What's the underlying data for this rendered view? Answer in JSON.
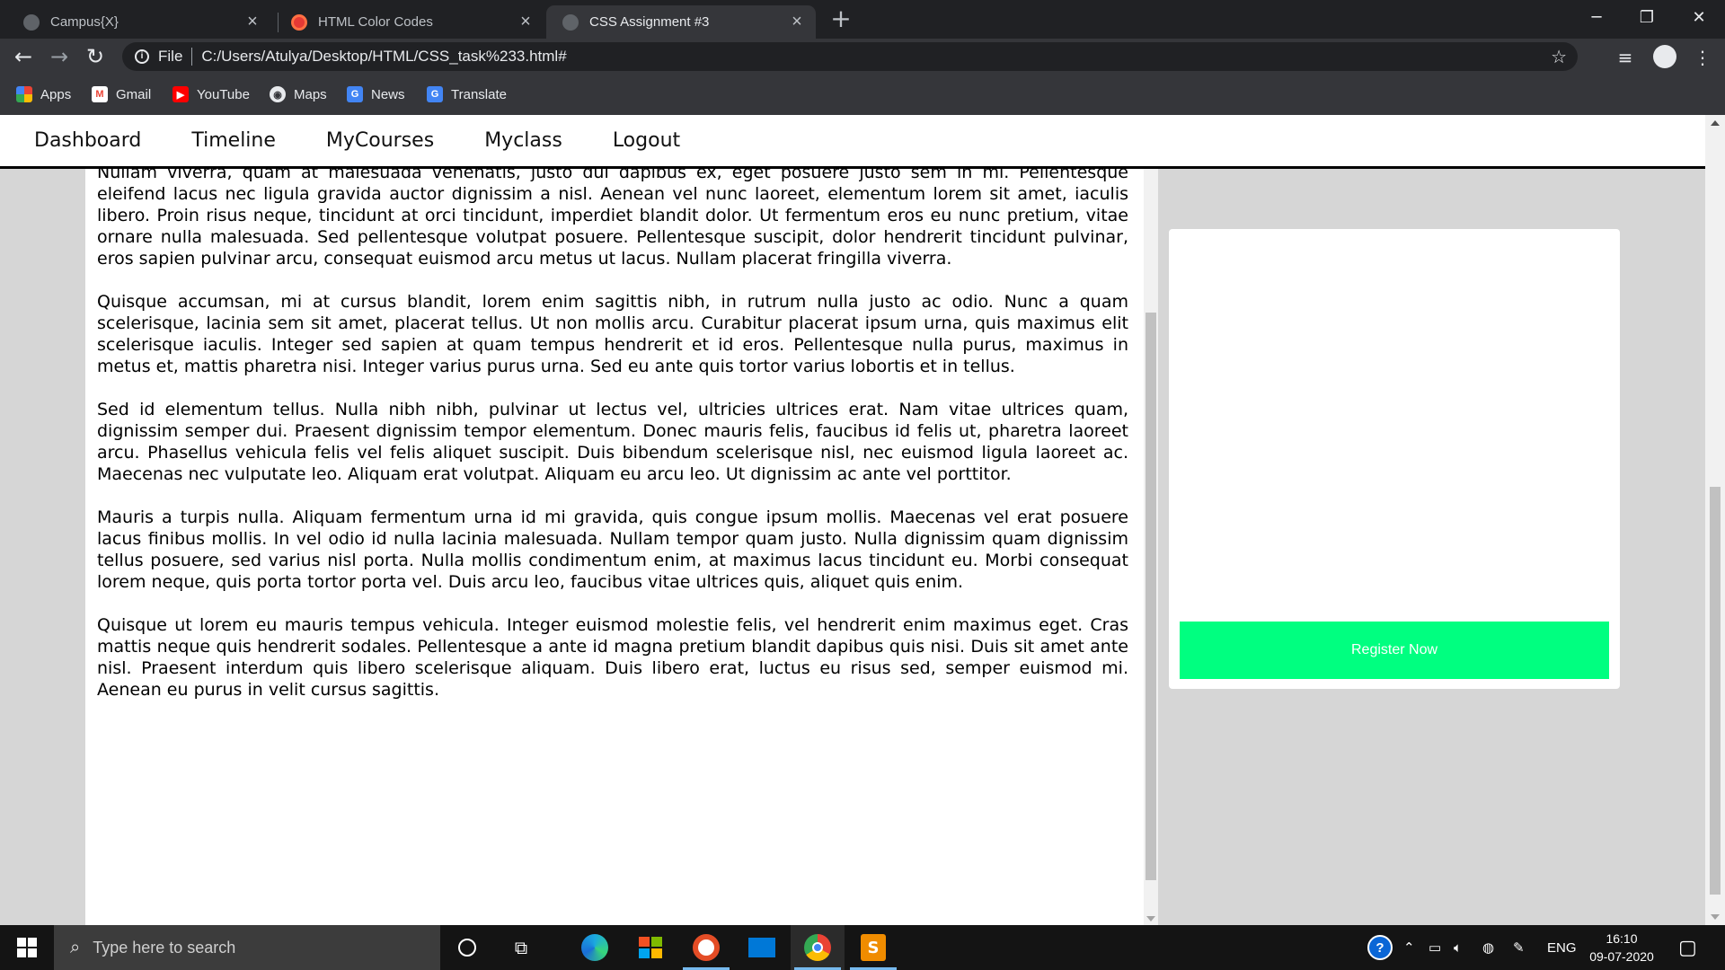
{
  "browser": {
    "tabs": [
      {
        "title": "Campus{X}",
        "active": false
      },
      {
        "title": "HTML Color Codes",
        "active": false
      },
      {
        "title": "CSS Assignment #3",
        "active": true
      }
    ],
    "address": {
      "scheme_label": "File",
      "url": "C:/Users/Atulya/Desktop/HTML/CSS_task%233.html#"
    },
    "bookmarks": [
      {
        "label": "Apps",
        "icon": "apps-grid-icon"
      },
      {
        "label": "Gmail",
        "icon": "gmail-icon"
      },
      {
        "label": "YouTube",
        "icon": "youtube-icon"
      },
      {
        "label": "Maps",
        "icon": "maps-icon"
      },
      {
        "label": "News",
        "icon": "news-icon"
      },
      {
        "label": "Translate",
        "icon": "translate-icon"
      }
    ]
  },
  "site": {
    "nav": [
      "Dashboard",
      "Timeline",
      "MyCourses",
      "Myclass",
      "Logout"
    ],
    "paragraphs": [
      "Nullam viverra, quam at malesuada venenatis, justo dui dapibus ex, eget posuere justo sem in mi. Pellentesque eleifend lacus nec ligula gravida auctor dignissim a nisl. Aenean vel nunc laoreet, elementum lorem sit amet, iaculis libero. Proin risus neque, tincidunt at orci tincidunt, imperdiet blandit dolor. Ut fermentum eros eu nunc pretium, vitae ornare nulla malesuada. Sed pellentesque volutpat posuere. Pellentesque suscipit, dolor hendrerit tincidunt pulvinar, eros sapien pulvinar arcu, consequat euismod arcu metus ut lacus. Nullam placerat fringilla viverra.",
      "Quisque accumsan, mi at cursus blandit, lorem enim sagittis nibh, in rutrum nulla justo ac odio. Nunc a quam scelerisque, lacinia sem sit amet, placerat tellus. Ut non mollis arcu. Curabitur placerat ipsum urna, quis maximus elit scelerisque iaculis. Integer sed sapien at quam tempus hendrerit et id eros. Pellentesque nulla purus, maximus in metus et, mattis pharetra nisi. Integer varius purus urna. Sed eu ante quis tortor varius lobortis et in tellus.",
      "Sed id elementum tellus. Nulla nibh nibh, pulvinar ut lectus vel, ultricies ultrices erat. Nam vitae ultrices quam, dignissim semper dui. Praesent dignissim tempor elementum. Donec mauris felis, faucibus id felis ut, pharetra laoreet arcu. Phasellus vehicula felis vel felis aliquet suscipit. Duis bibendum scelerisque nisl, nec euismod ligula laoreet ac. Maecenas nec vulputate leo. Aliquam erat volutpat. Aliquam eu arcu leo. Ut dignissim ac ante vel porttitor.",
      "Mauris a turpis nulla. Aliquam fermentum urna id mi gravida, quis congue ipsum mollis. Maecenas vel erat posuere lacus finibus mollis. In vel odio id nulla lacinia malesuada. Nullam tempor quam justo. Nulla dignissim quam dignissim tellus posuere, sed varius nisl porta. Nulla mollis condimentum enim, at maximus lacus tincidunt eu. Morbi consequat lorem neque, quis porta tortor porta vel. Duis arcu leo, faucibus vitae ultrices quis, aliquet quis enim.",
      "Quisque ut lorem eu mauris tempus vehicula. Integer euismod molestie felis, vel hendrerit enim maximus eget. Cras mattis neque quis hendrerit sodales. Pellentesque a ante id magna pretium blandit dapibus quis nisi. Duis sit amet ante nisl. Praesent interdum quis libero scelerisque aliquam. Duis libero erat, luctus eu risus sed, semper euismod mi. Aenean eu purus in velit cursus sagittis."
    ],
    "register_button": "Register Now",
    "colors": {
      "register_bg": "#00ff80",
      "page_bg": "#d6d6d6",
      "nav_border": "#000000"
    }
  },
  "taskbar": {
    "search_placeholder": "Type here to search",
    "language": "ENG",
    "time": "16:10",
    "date": "09-07-2020",
    "apps": [
      "cortana-icon",
      "task-view-icon",
      "edge-icon",
      "store-icon",
      "media-icon",
      "mail-icon",
      "chrome-icon",
      "sublime-icon"
    ]
  }
}
